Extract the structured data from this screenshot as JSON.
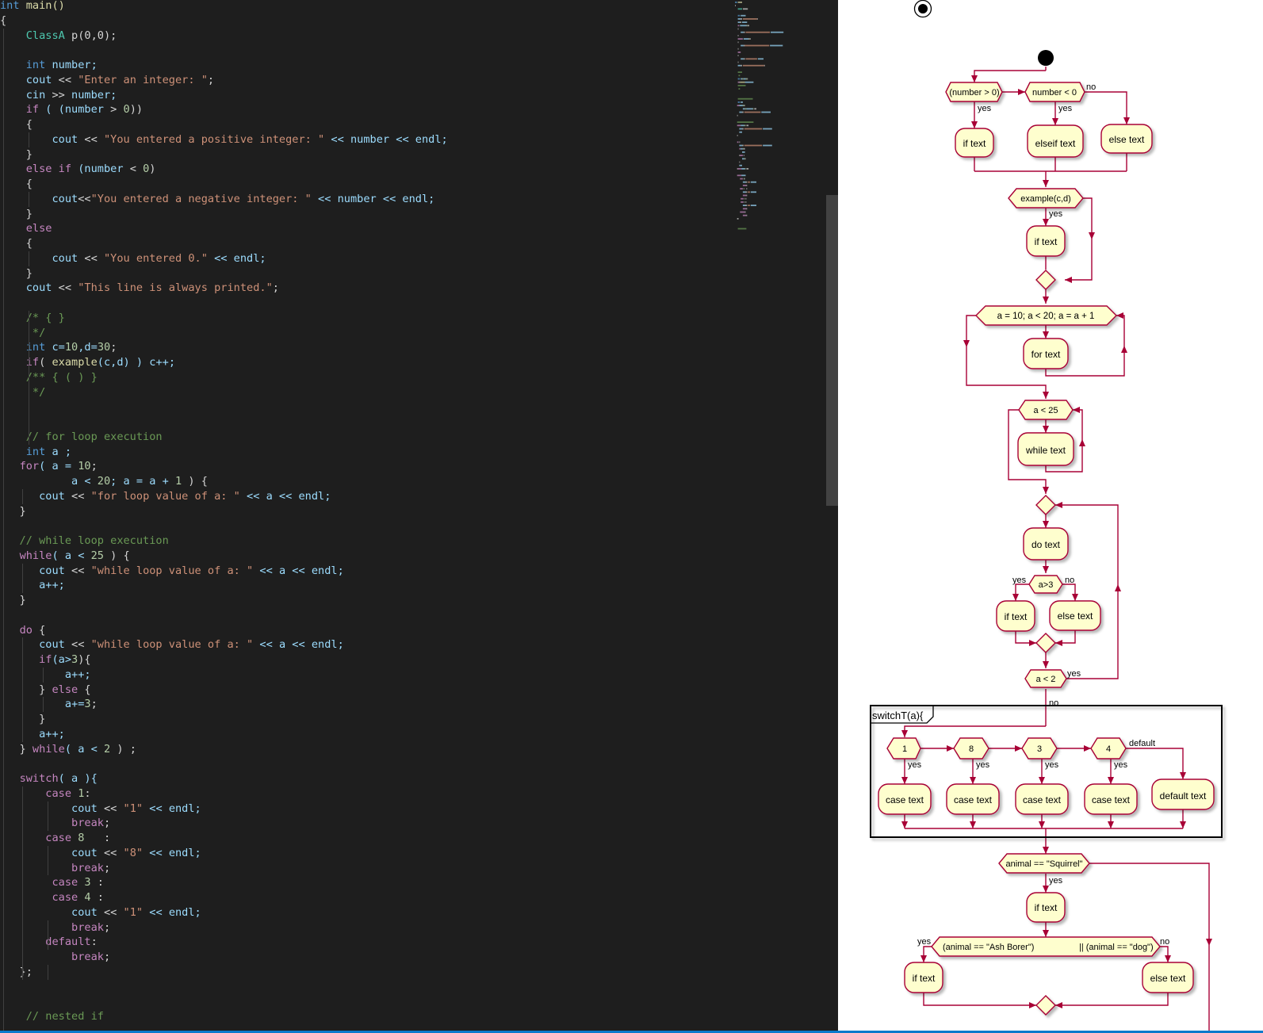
{
  "editor": {
    "code_lines": [
      [
        [
          "int",
          "kw"
        ],
        [
          " main()",
          "fn"
        ]
      ],
      [
        [
          "{",
          "pl"
        ]
      ],
      [
        [
          "    ",
          "pl"
        ],
        [
          "ClassA",
          "ty"
        ],
        [
          " p(0,0);",
          "pl"
        ]
      ],
      [],
      [
        [
          "    ",
          "pl"
        ],
        [
          "int",
          "kw"
        ],
        [
          " number;",
          "var"
        ]
      ],
      [
        [
          "    cout ",
          "var"
        ],
        [
          "<<",
          "pl"
        ],
        [
          " \"Enter an integer: \"",
          "str"
        ],
        [
          ";",
          "pl"
        ]
      ],
      [
        [
          "    cin ",
          "var"
        ],
        [
          ">>",
          "pl"
        ],
        [
          " number;",
          "var"
        ]
      ],
      [
        [
          "    ",
          "pl"
        ],
        [
          "if",
          "ctl"
        ],
        [
          " ( (number ",
          "var"
        ],
        [
          "> ",
          "pl"
        ],
        [
          "0",
          "num"
        ],
        [
          "))",
          "pl"
        ]
      ],
      [
        [
          "    {",
          "pl"
        ]
      ],
      [
        [
          "        cout ",
          "var"
        ],
        [
          "<<",
          "pl"
        ],
        [
          " \"You entered a positive integer: \"",
          "str"
        ],
        [
          " << number << endl;",
          "var"
        ]
      ],
      [
        [
          "    }",
          "pl"
        ]
      ],
      [
        [
          "    ",
          "pl"
        ],
        [
          "else if",
          "ctl"
        ],
        [
          " (number ",
          "var"
        ],
        [
          "< ",
          "pl"
        ],
        [
          "0",
          "num"
        ],
        [
          ")",
          "pl"
        ]
      ],
      [
        [
          "    {",
          "pl"
        ]
      ],
      [
        [
          "        cout",
          "var"
        ],
        [
          "<<",
          "pl"
        ],
        [
          "\"You entered a negative integer: \"",
          "str"
        ],
        [
          " << number << endl;",
          "var"
        ]
      ],
      [
        [
          "    }",
          "pl"
        ]
      ],
      [
        [
          "    ",
          "pl"
        ],
        [
          "else",
          "ctl"
        ]
      ],
      [
        [
          "    {",
          "pl"
        ]
      ],
      [
        [
          "        cout ",
          "var"
        ],
        [
          "<<",
          "pl"
        ],
        [
          " \"You entered 0.\"",
          "str"
        ],
        [
          " << endl;",
          "var"
        ]
      ],
      [
        [
          "    }",
          "pl"
        ]
      ],
      [
        [
          "    cout ",
          "var"
        ],
        [
          "<<",
          "pl"
        ],
        [
          " \"This line is always printed.\"",
          "str"
        ],
        [
          ";",
          "pl"
        ]
      ],
      [],
      [
        [
          "    /* { }",
          "cmt"
        ]
      ],
      [
        [
          "     */",
          "cmt"
        ]
      ],
      [
        [
          "    ",
          "pl"
        ],
        [
          "int",
          "kw"
        ],
        [
          " c=",
          "var"
        ],
        [
          "10",
          "num"
        ],
        [
          ",d=",
          "var"
        ],
        [
          "30",
          "num"
        ],
        [
          ";",
          "pl"
        ]
      ],
      [
        [
          "    ",
          "pl"
        ],
        [
          "if",
          "ctl"
        ],
        [
          "( ",
          "pl"
        ],
        [
          "example",
          "fn"
        ],
        [
          "(c,d) ) c++;",
          "var"
        ]
      ],
      [
        [
          "    /** { ( ) }",
          "cmt"
        ]
      ],
      [
        [
          "     */",
          "cmt"
        ]
      ],
      [],
      [],
      [
        [
          "    // for loop execution",
          "cmt"
        ]
      ],
      [
        [
          "    ",
          "pl"
        ],
        [
          "int",
          "kw"
        ],
        [
          " a ;",
          "var"
        ]
      ],
      [
        [
          "   ",
          "pl"
        ],
        [
          "for",
          "ctl"
        ],
        [
          "( a = ",
          "var"
        ],
        [
          "10",
          "num"
        ],
        [
          ";",
          "pl"
        ]
      ],
      [
        [
          "           a < ",
          "var"
        ],
        [
          "20",
          "num"
        ],
        [
          "; a = a + ",
          "var"
        ],
        [
          "1",
          "num"
        ],
        [
          " ) {",
          "pl"
        ]
      ],
      [
        [
          "      cout ",
          "var"
        ],
        [
          "<<",
          "pl"
        ],
        [
          " \"for loop value of a: \"",
          "str"
        ],
        [
          " << a << endl;",
          "var"
        ]
      ],
      [
        [
          "   }",
          "pl"
        ]
      ],
      [],
      [
        [
          "   // while loop execution",
          "cmt"
        ]
      ],
      [
        [
          "   ",
          "pl"
        ],
        [
          "while",
          "ctl"
        ],
        [
          "( a < ",
          "var"
        ],
        [
          "25",
          "num"
        ],
        [
          " ) {",
          "pl"
        ]
      ],
      [
        [
          "      cout ",
          "var"
        ],
        [
          "<<",
          "pl"
        ],
        [
          " \"while loop value of a: \"",
          "str"
        ],
        [
          " << a << endl;",
          "var"
        ]
      ],
      [
        [
          "      a++;",
          "var"
        ]
      ],
      [
        [
          "   }",
          "pl"
        ]
      ],
      [],
      [
        [
          "   ",
          "pl"
        ],
        [
          "do",
          "ctl"
        ],
        [
          " {",
          "pl"
        ]
      ],
      [
        [
          "      cout ",
          "var"
        ],
        [
          "<<",
          "pl"
        ],
        [
          " \"while loop value of a: \"",
          "str"
        ],
        [
          " << a << endl;",
          "var"
        ]
      ],
      [
        [
          "      ",
          "pl"
        ],
        [
          "if",
          "ctl"
        ],
        [
          "(a>",
          "var"
        ],
        [
          "3",
          "num"
        ],
        [
          "){",
          "pl"
        ]
      ],
      [
        [
          "          a++;",
          "var"
        ]
      ],
      [
        [
          "      } ",
          "pl"
        ],
        [
          "else",
          "ctl"
        ],
        [
          " {",
          "pl"
        ]
      ],
      [
        [
          "          a+=",
          "var"
        ],
        [
          "3",
          "num"
        ],
        [
          ";",
          "pl"
        ]
      ],
      [
        [
          "      }",
          "pl"
        ]
      ],
      [
        [
          "      a++;",
          "var"
        ]
      ],
      [
        [
          "   } ",
          "pl"
        ],
        [
          "while",
          "ctl"
        ],
        [
          "( a < ",
          "var"
        ],
        [
          "2",
          "num"
        ],
        [
          " ) ;",
          "pl"
        ]
      ],
      [],
      [
        [
          "   ",
          "pl"
        ],
        [
          "switch",
          "ctl"
        ],
        [
          "( a ){",
          "var"
        ]
      ],
      [
        [
          "       ",
          "pl"
        ],
        [
          "case",
          "ctl"
        ],
        [
          " ",
          "pl"
        ],
        [
          "1",
          "num"
        ],
        [
          ":",
          "pl"
        ]
      ],
      [
        [
          "           cout ",
          "var"
        ],
        [
          "<<",
          "pl"
        ],
        [
          " \"1\"",
          "str"
        ],
        [
          " << endl;",
          "var"
        ]
      ],
      [
        [
          "           ",
          "pl"
        ],
        [
          "break",
          "ctl"
        ],
        [
          ";",
          "pl"
        ]
      ],
      [
        [
          "       ",
          "pl"
        ],
        [
          "case",
          "ctl"
        ],
        [
          " ",
          "pl"
        ],
        [
          "8",
          "num"
        ],
        [
          "   :",
          "pl"
        ]
      ],
      [
        [
          "           cout ",
          "var"
        ],
        [
          "<<",
          "pl"
        ],
        [
          " \"8\"",
          "str"
        ],
        [
          " << endl;",
          "var"
        ]
      ],
      [
        [
          "           ",
          "pl"
        ],
        [
          "break",
          "ctl"
        ],
        [
          ";",
          "pl"
        ]
      ],
      [
        [
          "        ",
          "pl"
        ],
        [
          "case",
          "ctl"
        ],
        [
          " ",
          "pl"
        ],
        [
          "3",
          "num"
        ],
        [
          " :",
          "pl"
        ]
      ],
      [
        [
          "        ",
          "pl"
        ],
        [
          "case",
          "ctl"
        ],
        [
          " ",
          "pl"
        ],
        [
          "4",
          "num"
        ],
        [
          " :",
          "pl"
        ]
      ],
      [
        [
          "           cout ",
          "var"
        ],
        [
          "<<",
          "pl"
        ],
        [
          " \"1\"",
          "str"
        ],
        [
          " << endl;",
          "var"
        ]
      ],
      [
        [
          "           ",
          "pl"
        ],
        [
          "break",
          "ctl"
        ],
        [
          ";",
          "pl"
        ]
      ],
      [
        [
          "       ",
          "pl"
        ],
        [
          "default",
          "ctl"
        ],
        [
          ":",
          "pl"
        ]
      ],
      [
        [
          "           ",
          "pl"
        ],
        [
          "break",
          "ctl"
        ],
        [
          ";",
          "pl"
        ]
      ],
      [
        [
          "   };",
          "pl"
        ]
      ],
      [],
      [],
      [
        [
          "    // nested if",
          "cmt"
        ]
      ]
    ]
  },
  "diagram": {
    "if1_cond": "(number > 0)",
    "if2_cond": "number < 0",
    "if_text": "if text",
    "elseif_text": "elseif text",
    "else_text": "else text",
    "yes": "yes",
    "no": "no",
    "example_cond": "example(c,d)",
    "for_cond": "a = 10; a < 20; a = a + 1",
    "for_text": "for text",
    "while_cond": "a < 25",
    "while_text": "while text",
    "do_text": "do text",
    "do_if_cond": "a>3",
    "do_while_cond": "a < 2",
    "switch_label": "switchT(a){",
    "case_labels": [
      "1",
      "8",
      "3",
      "4"
    ],
    "case_text": "case text",
    "default_label": "default",
    "default_text": "default text",
    "animal_cond": "animal == \"Squirrel\"",
    "ash_cond_left": "(animal == \"Ash Borer\")",
    "ash_cond_right": "|| (animal == \"dog\")"
  },
  "colors": {
    "editor_bg": "#1e1e1e",
    "keyword": "#569cd6",
    "control": "#c586c0",
    "string": "#ce9178",
    "number": "#b5cea8",
    "comment": "#6a9955",
    "variable": "#9cdcfe",
    "function": "#dcdcaa",
    "type": "#4ec9b0",
    "diagram_stroke": "#a80036",
    "diagram_fill": "#fefece"
  }
}
